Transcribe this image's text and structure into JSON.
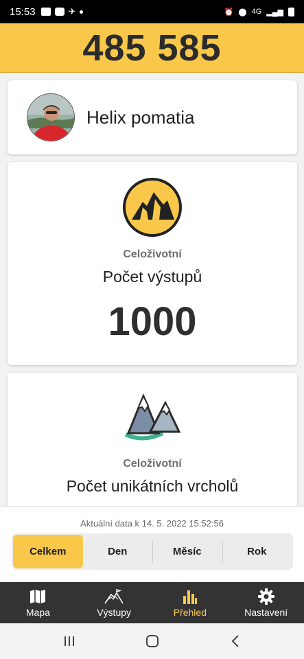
{
  "status_bar": {
    "time": "15:53",
    "network": "4G"
  },
  "header": {
    "score": "485 585"
  },
  "profile": {
    "name": "Helix pomatia"
  },
  "stats": [
    {
      "sublabel": "Celoživotní",
      "label": "Počet výstupů",
      "value": "1000",
      "icon": "mountain-badge-icon"
    },
    {
      "sublabel": "Celoživotní",
      "label": "Počet unikátních vrcholů",
      "icon": "mountain-peaks-icon"
    }
  ],
  "updated": "Aktuální data k 14. 5. 2022 15:52:56",
  "period_tabs": [
    {
      "label": "Celkem",
      "active": true
    },
    {
      "label": "Den",
      "active": false
    },
    {
      "label": "Měsíc",
      "active": false
    },
    {
      "label": "Rok",
      "active": false
    }
  ],
  "nav": [
    {
      "label": "Mapa",
      "icon": "map-icon",
      "active": false
    },
    {
      "label": "Výstupy",
      "icon": "summit-icon",
      "active": false
    },
    {
      "label": "Přehled",
      "icon": "bar-chart-icon",
      "active": true
    },
    {
      "label": "Nastavení",
      "icon": "gear-icon",
      "active": false
    }
  ],
  "colors": {
    "accent": "#f9c84a",
    "navbar": "#333333"
  }
}
